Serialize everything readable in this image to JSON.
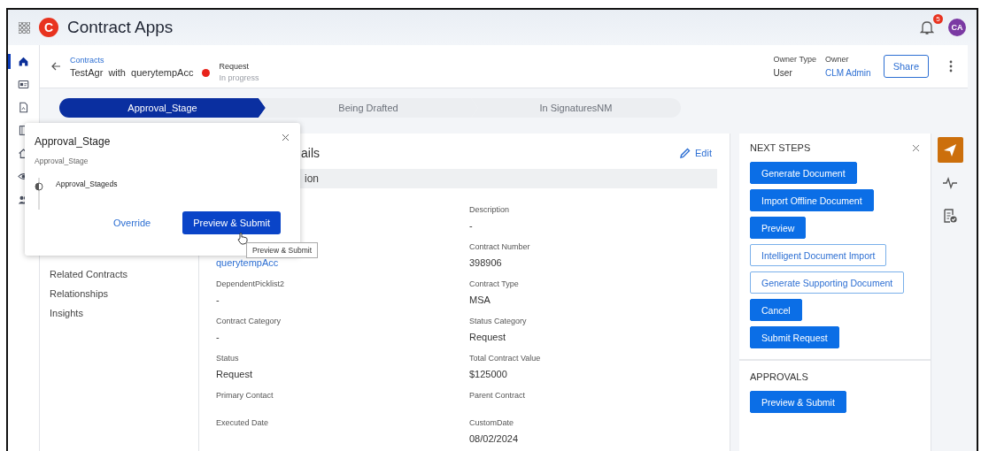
{
  "app": {
    "title": "Contract Apps",
    "logo": "C",
    "notifications": "5",
    "avatar": "CA"
  },
  "rail": [
    {
      "kind": "home",
      "selected": true
    },
    {
      "kind": "card",
      "selected": false
    },
    {
      "kind": "doc",
      "selected": false
    },
    {
      "kind": "book",
      "selected": false
    },
    {
      "kind": "house",
      "selected": false
    },
    {
      "kind": "eye",
      "selected": false
    },
    {
      "kind": "group",
      "selected": false
    }
  ],
  "record": {
    "breadcrumb": "Contracts",
    "title": "TestAgr  with  querytempAcc",
    "status": "Request",
    "substatus": "In progress",
    "owner_type_label": "Owner Type",
    "owner_type": "User",
    "owner_label": "Owner",
    "owner": "CLM Admin",
    "share": "Share"
  },
  "stages": [
    {
      "label": "Approval_Stage",
      "selected": true
    },
    {
      "label": "Being Drafted",
      "selected": false
    },
    {
      "label": "In SignaturesNM",
      "selected": false
    }
  ],
  "nav": [
    "Related Contracts",
    "Relationships",
    "Insights"
  ],
  "details": {
    "title": "ails",
    "edit": "Edit",
    "section": "ion",
    "left": [
      {
        "value": "querytempAcc",
        "link": true
      },
      {
        "label": "DependentPicklist2",
        "value": "-"
      },
      {
        "label": "Contract Category",
        "value": "-"
      },
      {
        "label": "Status",
        "value": "Request"
      },
      {
        "label": "Primary Contact"
      },
      {
        "label": "Executed Date"
      }
    ],
    "right": [
      {
        "label": "Description",
        "value": "-"
      },
      {
        "label": "Contract Number",
        "value": "398906"
      },
      {
        "label": "Contract Type",
        "value": "MSA"
      },
      {
        "label": "Status Category",
        "value": "Request"
      },
      {
        "label": "Total Contract Value",
        "value": "$125000"
      },
      {
        "label": "Parent Contract"
      },
      {
        "label": "CustomDate",
        "value": "08/02/2024"
      }
    ]
  },
  "next_steps": {
    "title": "NEXT STEPS",
    "buttons": [
      {
        "label": "Generate Document",
        "kind": "primary"
      },
      {
        "label": "Import Offline Document",
        "kind": "primary"
      },
      {
        "label": "Preview",
        "kind": "primary"
      },
      {
        "label": "Intelligent Document Import",
        "kind": "outline"
      },
      {
        "label": "Generate Supporting Document",
        "kind": "outline"
      },
      {
        "label": "Cancel",
        "kind": "primary"
      },
      {
        "label": "Submit Request",
        "kind": "primary"
      }
    ]
  },
  "approvals": {
    "title": "APPROVALS",
    "button": "Preview & Submit"
  },
  "side_tools": [
    {
      "kind": "send",
      "selected": true
    },
    {
      "kind": "activity",
      "selected": false
    },
    {
      "kind": "doc-check",
      "selected": false
    }
  ],
  "popover": {
    "title": "Approval_Stage",
    "subtitle": "Approval_Stage",
    "step": "Approval_Stageds",
    "override": "Override",
    "submit": "Preview & Submit",
    "tooltip": "Preview & Submit"
  }
}
